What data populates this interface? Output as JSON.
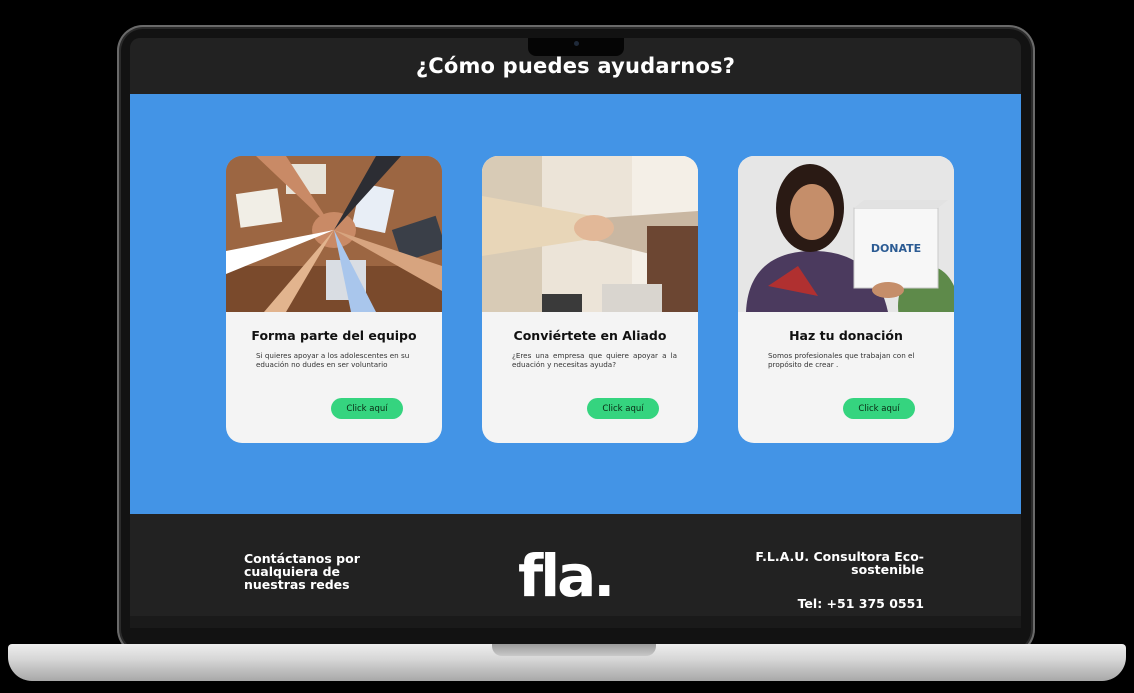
{
  "section": {
    "title": "¿Cómo puedes ayudarnos?"
  },
  "cards": [
    {
      "title": "Forma parte del equipo",
      "description": "Si quieres apoyar a los adolescentes en su eduación no dudes en ser voluntario",
      "button": "Click aquí"
    },
    {
      "title": "Conviértete en Aliado",
      "description": "¿Eres una empresa que quiere apoyar a la eduación y necesitas ayuda?",
      "button": "Click aquí"
    },
    {
      "title": "Haz tu donación",
      "description": "Somos profesionales que trabajan con el propósito de crear .",
      "button": "Click aquí",
      "box_label": "DONATE"
    }
  ],
  "footer": {
    "contact": "Contáctanos por cualquiera de nuestras redes",
    "logo": "fla.",
    "company": "F.L.A.U. Consultora Eco-sostenible",
    "phone": "Tel: +51 375 0551"
  },
  "colors": {
    "accent_blue": "#4394e6",
    "button_green": "#35d47f",
    "header_dark": "#222222"
  }
}
